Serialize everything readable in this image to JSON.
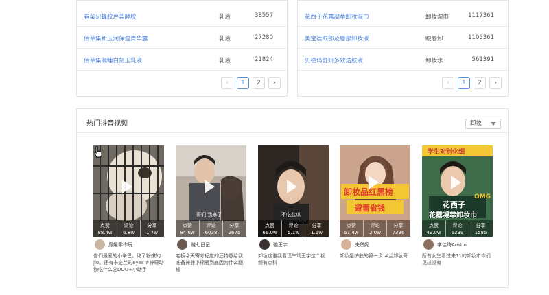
{
  "left_table": {
    "rows": [
      {
        "name": "春菜记蜂胶芦荟酵胶",
        "category": "乳液",
        "value": "38557"
      },
      {
        "name": "佰草集新玉润保湿青华露",
        "category": "乳液",
        "value": "27280"
      },
      {
        "name": "佰草集凝睡白刻玉乳液",
        "category": "乳液",
        "value": "21824"
      }
    ],
    "pager": {
      "prev": "‹",
      "pages": [
        "1",
        "2"
      ],
      "next": "›"
    }
  },
  "right_table": {
    "rows": [
      {
        "name": "花西子花露凝萃卸妆湿巾",
        "category": "卸妆湿巾",
        "value": "1117361"
      },
      {
        "name": "美宝莲眼部及唇部卸妆液",
        "category": "眼唇卸",
        "value": "1105361"
      },
      {
        "name": "贝德玛舒妍多效洁肤液",
        "category": "卸妆水",
        "value": "561391"
      }
    ],
    "pager": {
      "prev": "‹",
      "pages": [
        "1",
        "2"
      ],
      "next": "›"
    }
  },
  "videos": {
    "title": "热门抖音视频",
    "filter_selected": "卸妆",
    "cards": [
      {
        "likes_label": "点赞",
        "likes": "88.4w",
        "comments_label": "评论",
        "comments": "6.8w",
        "shares_label": "分享",
        "shares": "1.7w",
        "author": "鳳媛零你玩",
        "desc": "你们最爱的小辛巴，终了粉嫩的jio。还有卡姿兰的eyes #神奇动物吃什么@DOU+小助手"
      },
      {
        "likes_label": "点赞",
        "likes": "84.6w",
        "comments_label": "评论",
        "comments": "6038",
        "shares_label": "分享",
        "shares": "2675",
        "author": "贼七日记",
        "desc": "老板今天寄考程度的还特意给我准备神器小棉瓶到底因为什么翻橘"
      },
      {
        "likes_label": "点赞",
        "likes": "66.0w",
        "comments_label": "评论",
        "comments": "5.1w",
        "shares_label": "分享",
        "shares": "1.1w",
        "author": "骆王宇",
        "desc": "卸妆这谁我看现午场王宇这个视频有点科"
      },
      {
        "likes_label": "点赞",
        "likes": "51.4w",
        "comments_label": "评论",
        "comments": "2.0w",
        "shares_label": "分享",
        "shares": "7336",
        "author": "夫然妮",
        "desc": "卸妆是护肤的第一步 #兰卸妆膏"
      },
      {
        "likes_label": "点赞",
        "likes": "49.0w",
        "comments_label": "评论",
        "comments": "6339",
        "shares_label": "分享",
        "shares": "1585",
        "author": "李佳琦Austin",
        "desc": "所有女生看过来11的卸妆市你们见过没有"
      }
    ],
    "thumb_texts": {
      "card2_caption": "哥们 我来了",
      "card3_caption": "不吃盐瓜",
      "card4_banner1": "卸妆品红黑榜",
      "card4_banner2": "避雷省钱",
      "card5_top": "学生对别化细",
      "card5_mid": "花西子",
      "card5_bottom": "花露凝萃卸妆巾",
      "card5_badge": "OMG"
    }
  },
  "colors": {
    "link": "#4a7fd6",
    "accent": "#4a90e2",
    "border": "#e5e5e5",
    "banner_yellow": "#f3c633",
    "banner_red": "#e0392f"
  }
}
